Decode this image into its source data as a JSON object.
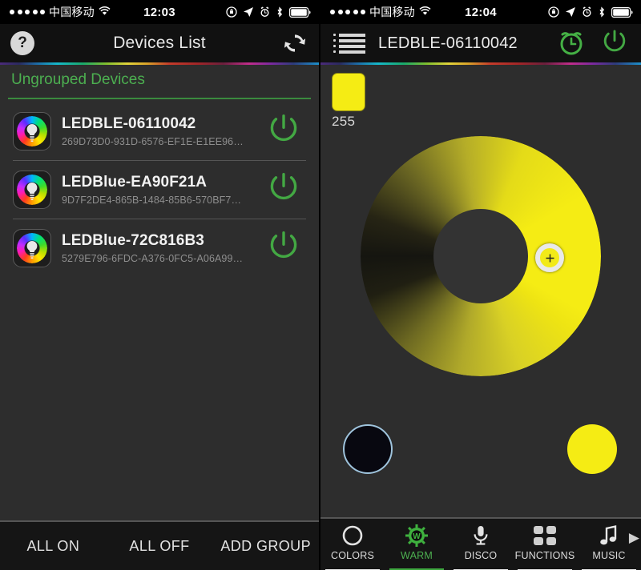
{
  "colors": {
    "accent_green": "#4caf50",
    "yellow": "#f5ec14",
    "bg_dark": "#2d2d2d",
    "bar_dark": "#151515"
  },
  "left": {
    "statusbar": {
      "carrier": "中国移动",
      "time": "12:03",
      "signal_dots": 5,
      "icons": [
        "wifi-icon",
        "rotation-lock-icon",
        "location-arrow-icon",
        "alarm-clock-icon",
        "bluetooth-icon",
        "battery-icon"
      ]
    },
    "navbar": {
      "help_label": "?",
      "title": "Devices List",
      "refresh_icon": "refresh-icon"
    },
    "group": {
      "title": "Ungrouped Devices"
    },
    "devices": [
      {
        "name": "LEDBLE-06110042",
        "uuid": "269D73D0-931D-6576-EF1E-E1EE96…",
        "icon": "rgb-bulb-icon",
        "power_icon": "power-icon"
      },
      {
        "name": "LEDBlue-EA90F21A",
        "uuid": "9D7F2DE4-865B-1484-85B6-570BF7…",
        "icon": "rgb-bulb-icon",
        "power_icon": "power-icon"
      },
      {
        "name": "LEDBlue-72C816B3",
        "uuid": "5279E796-6FDC-A376-0FC5-A06A99…",
        "icon": "rgb-bulb-icon",
        "power_icon": "power-icon"
      }
    ],
    "bottombar": {
      "all_on": "ALL ON",
      "all_off": "ALL OFF",
      "add_group": "ADD GROUP"
    }
  },
  "right": {
    "statusbar": {
      "carrier": "中国移动",
      "time": "12:04",
      "signal_dots": 5
    },
    "navbar": {
      "menu_icon": "list-menu-icon",
      "title": "LEDBLE-06110042",
      "alarm_icon": "alarm-clock-icon",
      "power_icon": "power-icon"
    },
    "swatch": {
      "color": "#f5ec14",
      "value": "255"
    },
    "wheel": {
      "name": "warm-color-wheel",
      "knob_icon": "crosshair-icon"
    },
    "presets": [
      {
        "name": "preset-min",
        "color": "#080810"
      },
      {
        "name": "preset-max",
        "color": "#f5ec14"
      }
    ],
    "tabs": [
      {
        "label": "COLORS",
        "icon": "circle-icon",
        "active": false
      },
      {
        "label": "WARM",
        "icon": "sun-w-icon",
        "active": true
      },
      {
        "label": "DISCO",
        "icon": "microphone-icon",
        "active": false
      },
      {
        "label": "FUNCTIONS",
        "icon": "grid-squares-icon",
        "active": false
      },
      {
        "label": "MUSIC",
        "icon": "music-note-icon",
        "active": false
      }
    ],
    "tabs_more": "▶"
  }
}
